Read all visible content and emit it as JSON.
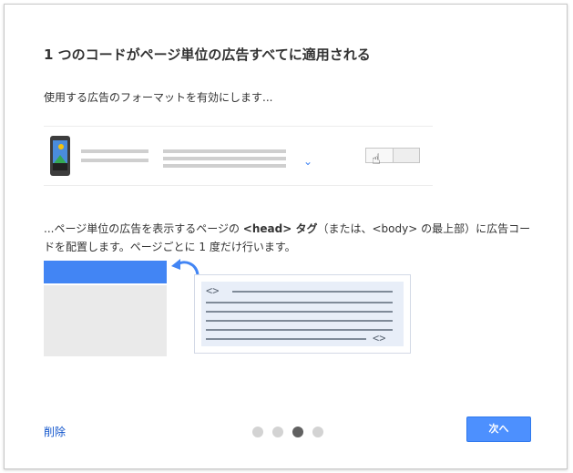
{
  "dialog": {
    "title": "1 つのコードがページ単位の広告すべてに適用される",
    "subtitle": "使用する広告のフォーマットを有効にします...",
    "desc": {
      "part1": "...ページ単位の広告を表示するページの",
      "head_tag": "<head> タグ",
      "part2": "（または、<body> の最上部）に広告コードを配置します。ページごとに 1 度だけ行います。"
    },
    "code_open_tag": "<>",
    "code_close_tag": "<>",
    "toggle_state": "off"
  },
  "footer": {
    "delete_label": "削除",
    "next_label": "次へ",
    "pagination": {
      "total": 4,
      "active_index": 2
    }
  },
  "colors": {
    "accent": "#4285f4",
    "button": "#4d90fe",
    "link": "#1155cc"
  }
}
